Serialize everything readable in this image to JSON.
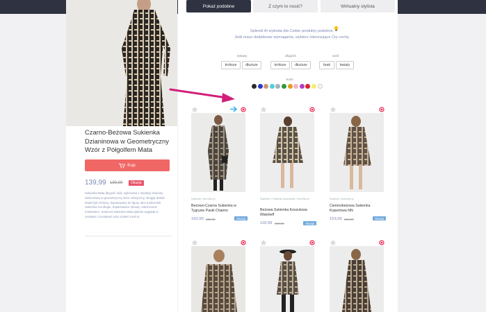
{
  "tabs": {
    "similar": "Pokaż podobne",
    "combine": "Z czym to nosić?",
    "stylist": "Wirtualny stylista"
  },
  "intro": {
    "line1": "Splendi AI wybrała dla Ciebie produkty podobne.",
    "line2": "Jeśli masz dodatkowe wymagania, wybierz interesujące Cię cechy."
  },
  "filters": {
    "sleeves": {
      "label": "rękawy",
      "opt1": "krótsze",
      "opt2": "dłuższe"
    },
    "length": {
      "label": "długość",
      "opt1": "krótsze",
      "opt2": "dłuższe"
    },
    "pattern": {
      "label": "wzór",
      "opt1": "brak",
      "opt2": "kwiaty"
    },
    "color": {
      "label": "kolor"
    }
  },
  "colors": [
    "#2b2b2b",
    "#2b39c8",
    "#c9957a",
    "#4fd0dc",
    "#a8b0b8",
    "#2f9a3a",
    "#e0a020",
    "#f3b4c6",
    "#b23fc3",
    "#e0202a",
    "#f4f070",
    "#f6f6f6"
  ],
  "product": {
    "title": "Czarno-Beżowa Sukienka Dzianinowa w Geometryczny Wzór z Półgolfem Mata",
    "buy_label": "Kup",
    "price": "139,99",
    "old_price": "199,99",
    "badge": "Okazja",
    "description": "Sukienka Mata długość midi, wykonana z miękkiej dzianiny wiskozowej w geometryczny wzór. Klasyczny, okrągły dekolt. Model tyłu krótszy, dopasowany do figury. Bez podszewki. Sukienka ma długie, dopasowane rękawy, zakończone mankietem. Jesienna sukienka Mata pięknie wygląda w zestawie z kozakami oraz szalem merino."
  },
  "cards": [
    {
      "crumb": "Sukienki / born2be.pl",
      "title": "Beżowo-Czarna Sukienka w Tygrysie Paski Chaimo",
      "price": "160,99",
      "old": "229,99",
      "badge": "Okazja"
    },
    {
      "crumb": "Sukienki > Sukienki koszulowe / born2be.pl",
      "title": "Beżowa Sukienka Koszulowa Watsheff",
      "price": "118,99",
      "old": "169,99",
      "badge": "Okazja"
    },
    {
      "crumb": "Sukienki / born2be.pl",
      "title": "Ciemnobeżowa Sukienka Kopertowa NN",
      "price": "153,99",
      "old": "219,99",
      "badge": "Okazja"
    }
  ],
  "icons": {
    "bulb": "lightbulb-icon",
    "star": "star-icon",
    "target": "target-icon",
    "cart": "cart-icon",
    "arrow": "annotation-arrow-icon"
  },
  "accent": "#7d89b5",
  "buy_color": "#f06766"
}
